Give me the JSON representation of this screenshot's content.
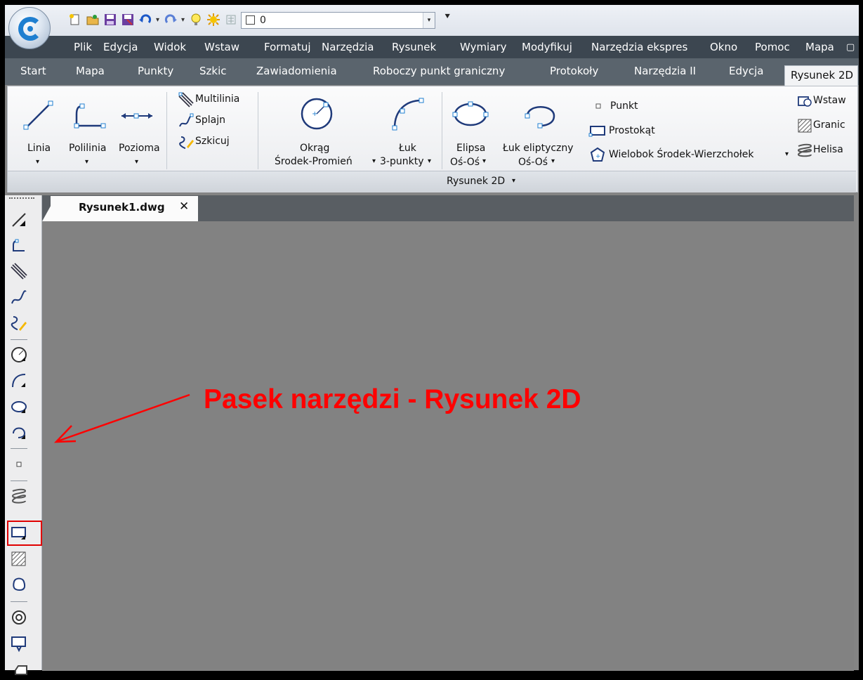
{
  "quick_access": {
    "layer_value": "0",
    "customize_glyph": "⯆"
  },
  "menu": {
    "items": [
      "Plik",
      "Edycja",
      "Widok",
      "Wstaw",
      "Formatuj",
      "Narzędzia",
      "Rysunek",
      "Wymiary",
      "Modyfikuj",
      "Narzędzia ekspres",
      "Okno",
      "Pomoc",
      "Mapa"
    ]
  },
  "tabs": {
    "items": [
      "Start",
      "Mapa",
      "Punkty",
      "Szkic",
      "Zawiadomienia",
      "Roboczy punkt graniczny",
      "Protokoły",
      "Narzędzia II",
      "Edycja"
    ],
    "active": "Rysunek 2D"
  },
  "ribbon": {
    "linia": "Linia",
    "polilinia": "Polilinia",
    "pozioma": "Pozioma",
    "multilinia": "Multilinia",
    "splajn": "Splajn",
    "szkicuj": "Szkicuj",
    "okrag_1": "Okrąg",
    "okrag_2": "Środek-Promień",
    "luk_1": "Łuk",
    "luk_2": "3-punkty",
    "elipsa_1": "Elipsa",
    "elipsa_2": "Oś-Oś",
    "luk_elipt_1": "Łuk eliptyczny",
    "luk_elipt_2": "Oś-Oś",
    "punkt": "Punkt",
    "prostokat": "Prostokąt",
    "wielobok": "Wielobok Środek-Wierzchołek",
    "wstaw": "Wstaw",
    "granic": "Granic",
    "helisa": "Helisa",
    "panel_title": "Rysunek 2D",
    "dropdown_glyph": "▾"
  },
  "document": {
    "tab_name": "Rysunek1.dwg",
    "close_glyph": "✕"
  },
  "annotation": {
    "text": "Pasek narzędzi - Rysunek 2D",
    "color": "#ff0000"
  },
  "colors": {
    "menubar_bg": "#3c4650",
    "tabbar_bg": "#5a646d",
    "canvas_bg": "#828282",
    "accent_blue": "#1f7fd0"
  }
}
